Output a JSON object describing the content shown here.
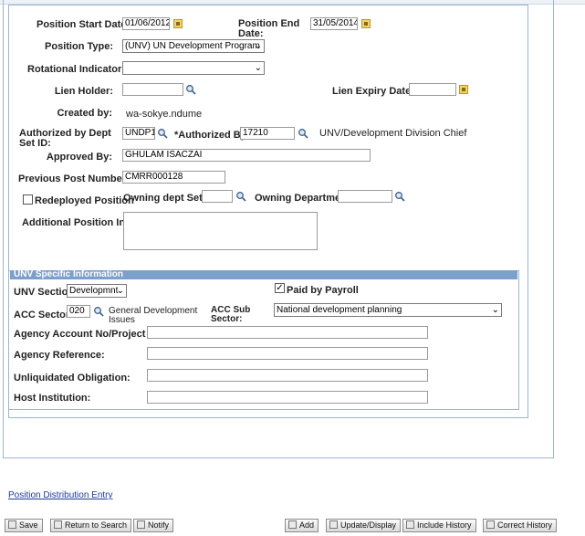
{
  "form": {
    "position_start_date_label": "Position Start Date:",
    "position_start_date": "01/06/2012",
    "position_end_date_label": "Position End Date:",
    "position_end_date": "31/05/2014",
    "position_type_label": "Position Type:",
    "position_type": "(UNV) UN Development Program",
    "rotational_indicator_label": "Rotational Indicator:",
    "rotational_indicator": "",
    "lien_holder_label": "Lien Holder:",
    "lien_holder": "",
    "lien_expiry_date_label": "Lien Expiry Date:",
    "lien_expiry_date": "",
    "created_by_label": "Created by:",
    "created_by": "wa-sokye.ndume",
    "authorized_by_dept_set_id_label": "Authorized by Dept Set ID:",
    "authorized_by_dept_set_id": "UNDP1",
    "authorized_by_label": "*Authorized By:",
    "authorized_by": "17210",
    "authorized_by_desc": "UNV/Development Division Chief",
    "approved_by_label": "Approved By:",
    "approved_by": "GHULAM ISACZAI",
    "previous_post_number_label": "Previous Post Number:",
    "previous_post_number": "CMRR000128",
    "redeployed_position_label": "Redeployed Position",
    "owning_dept_set_id_label": "Owning dept Set ID:",
    "owning_dept_set_id": "",
    "owning_department_label": "Owning Department:",
    "owning_department": "",
    "additional_position_info_label": "Additional Position Info:",
    "additional_position_info": ""
  },
  "unv": {
    "section_title": "UNV Specific Information",
    "unv_section_label": "UNV Section:",
    "unv_section": "Developmnt",
    "paid_by_payroll_label": "Paid by Payroll",
    "paid_by_payroll_checked": "✓",
    "acc_sector_label": "ACC Sector:",
    "acc_sector": "020",
    "acc_sector_desc": "General Development Issues",
    "acc_sub_sector_label": "ACC Sub Sector:",
    "acc_sub_sector": "National development planning",
    "agency_account_label": "Agency Account No/Project Code:",
    "agency_reference_label": "Agency Reference:",
    "unliquidated_obligation_label": "Unliquidated Obligation:",
    "host_institution_label": "Host Institution:"
  },
  "links": {
    "position_distribution_entry": "Position Distribution Entry"
  },
  "toolbar": {
    "save": "Save",
    "return_to_search": "Return to Search",
    "notify": "Notify",
    "add": "Add",
    "update_display": "Update/Display",
    "include_history": "Include History",
    "correct_history": "Correct History"
  },
  "icons": {
    "calendar": "calendar-icon",
    "lookup": "magnifier-icon",
    "dropdown": "chevron-down-icon"
  },
  "colors": {
    "section_header_bg": "#7d9fcb",
    "border": "#9cb5d2",
    "link": "#1a3c9a"
  }
}
